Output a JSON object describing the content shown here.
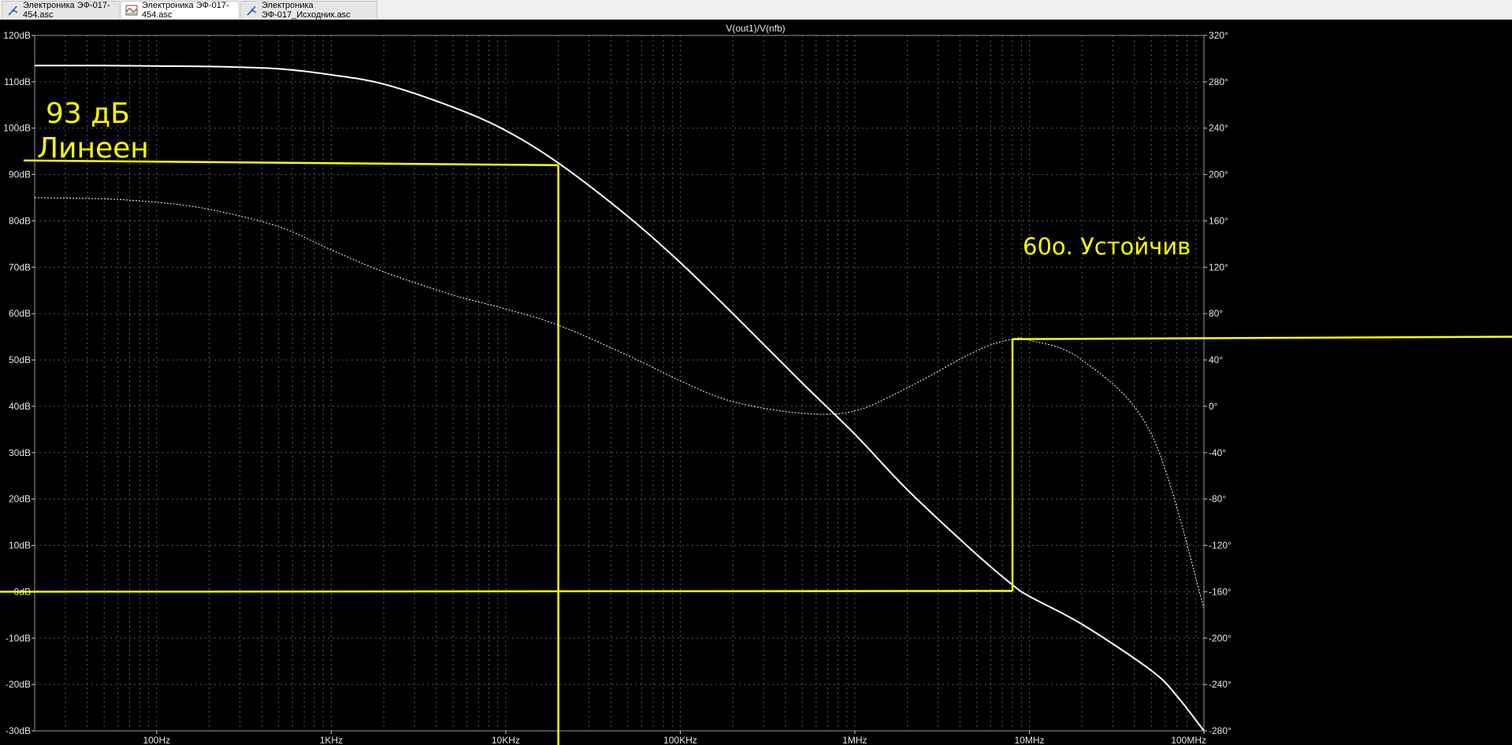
{
  "tabs": [
    {
      "label": "Электроника ЭФ-017-454.asc",
      "icon": "schematic-icon",
      "active": false
    },
    {
      "label": "Электроника ЭФ-017-454.asc",
      "icon": "waveform-icon",
      "active": true
    },
    {
      "label": "Электроника ЭФ-017_Исходник.asc",
      "icon": "schematic-icon",
      "active": false
    }
  ],
  "colors": {
    "background": "#000000",
    "grid": "#5a5a5a",
    "magnitude": "#ffffff",
    "phase": "#ffffff",
    "annotation": "#ffff00"
  },
  "annotations": {
    "gain_text": "93 дБ",
    "linear_text": "Линеен",
    "stability_text": "60о. Устойчив"
  },
  "chart_data": {
    "type": "line",
    "title": "V(out1)/V(nfb)",
    "x_scale": "log",
    "xlim": [
      20,
      100000000
    ],
    "x_ticks": [
      100,
      1000,
      10000,
      100000,
      1000000,
      10000000,
      100000000
    ],
    "x_tick_labels": [
      "100Hz",
      "1KHz",
      "10KHz",
      "100KHz",
      "1MHz",
      "10MHz",
      "100MHz"
    ],
    "ylim_left": [
      -30,
      120
    ],
    "y_ticks_left": [
      120,
      110,
      100,
      90,
      80,
      70,
      60,
      50,
      40,
      30,
      20,
      10,
      0,
      -10,
      -20,
      -30
    ],
    "y_tick_labels_left": [
      "120dB",
      "110dB",
      "100dB",
      "90dB",
      "80dB",
      "70dB",
      "60dB",
      "50dB",
      "40dB",
      "30dB",
      "20dB",
      "10dB",
      "0dB",
      "-10dB",
      "-20dB",
      "-30dB"
    ],
    "ylim_right": [
      -280,
      320
    ],
    "y_ticks_right": [
      320,
      280,
      240,
      200,
      160,
      120,
      80,
      40,
      0,
      -40,
      -80,
      -120,
      -160,
      -200,
      -240,
      -280
    ],
    "y_tick_labels_right": [
      "320°",
      "280°",
      "240°",
      "200°",
      "160°",
      "120°",
      "80°",
      "40°",
      "0°",
      "-40°",
      "-80°",
      "-120°",
      "-160°",
      "-200°",
      "-240°",
      "-280°"
    ],
    "grid": true,
    "series": [
      {
        "axis": "left",
        "style": "solid",
        "x": [
          20,
          50,
          100,
          200,
          500,
          1000,
          2000,
          5000,
          10000,
          20000,
          50000,
          100000,
          200000,
          500000,
          1000000,
          2000000,
          5000000,
          8000000,
          10000000,
          20000000,
          50000000,
          70000000,
          100000000
        ],
        "y": [
          113.5,
          113.5,
          113.4,
          113.3,
          112.8,
          111.5,
          109.5,
          104.5,
          99.5,
          92.5,
          81,
          71,
          60,
          45,
          34,
          22,
          8,
          1.5,
          -1,
          -7,
          -17,
          -22.5,
          -30
        ]
      },
      {
        "axis": "right",
        "style": "dotted",
        "x": [
          20,
          50,
          100,
          200,
          500,
          1000,
          2000,
          5000,
          10000,
          20000,
          50000,
          100000,
          200000,
          500000,
          1000000,
          2000000,
          5000000,
          8000000,
          10000000,
          20000000,
          50000000,
          100000000
        ],
        "y": [
          180,
          179,
          176,
          170,
          155,
          135,
          116,
          96,
          84,
          70,
          44,
          22,
          4,
          -6,
          -4,
          16,
          48,
          58,
          57,
          40,
          -24,
          -174
        ]
      }
    ],
    "markers": {
      "gain_level_db": 92,
      "gain_freq_hz": 20000,
      "zero_db": 0,
      "unity_freq_hz": 8000000,
      "phase_level_deg": 58
    }
  }
}
